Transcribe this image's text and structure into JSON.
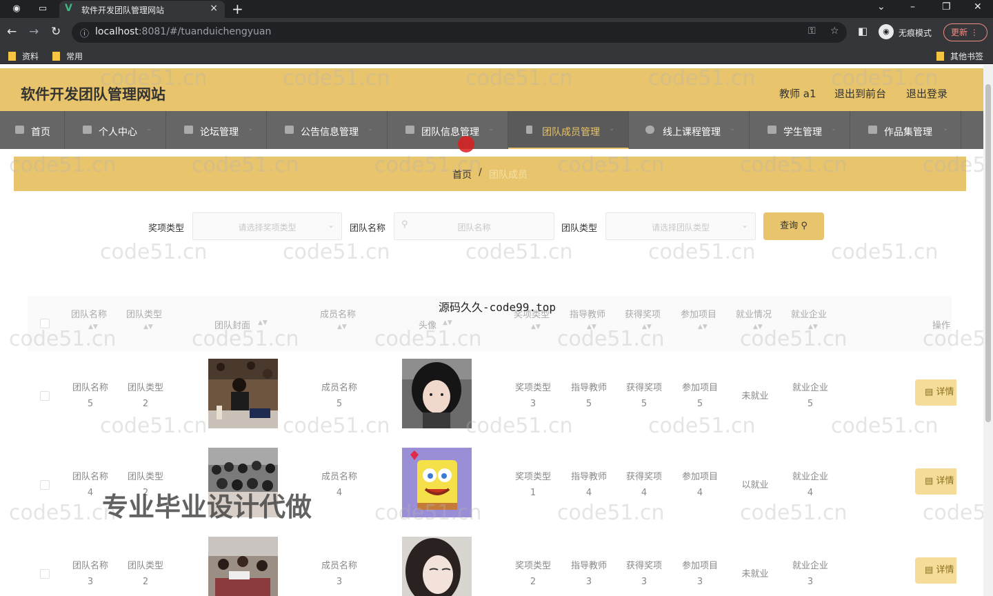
{
  "browser": {
    "tab_title": "软件开发团队管理网站",
    "url_host": "localhost",
    "url_rest": ":8081/#/tuanduichengyuan",
    "incognito_label": "无痕模式",
    "update_label": "更新",
    "bookmarks": [
      "资料",
      "常用"
    ],
    "other_bookmarks": "其他书签"
  },
  "site": {
    "title": "软件开发团队管理网站",
    "header_links": [
      "教师 a1",
      "退出到前台",
      "退出登录"
    ]
  },
  "nav": [
    {
      "label": "首页"
    },
    {
      "label": "个人中心"
    },
    {
      "label": "论坛管理"
    },
    {
      "label": "公告信息管理"
    },
    {
      "label": "团队信息管理"
    },
    {
      "label": "团队成员管理"
    },
    {
      "label": "线上课程管理"
    },
    {
      "label": "学生管理"
    },
    {
      "label": "作品集管理"
    }
  ],
  "breadcrumb": {
    "home": "首页",
    "sep": "/",
    "current": "团队成员"
  },
  "filters": {
    "award_label": "奖项类型",
    "award_placeholder": "请选择奖项类型",
    "team_name_label": "团队名称",
    "team_name_placeholder": "团队名称",
    "team_type_label": "团队类型",
    "team_type_placeholder": "请选择团队类型",
    "query_label": "查询"
  },
  "table": {
    "headers": [
      "团队名称",
      "团队类型",
      "团队封面",
      "成员名称",
      "头像",
      "奖项类型",
      "指导教师",
      "获得奖项",
      "参加项目",
      "就业情况",
      "就业企业",
      "操作"
    ],
    "detail_label": "详情",
    "rows": [
      {
        "team_name": "团队名称",
        "team_name_no": "5",
        "team_type": "团队类型",
        "team_type_no": "2",
        "member": "成员名称",
        "member_no": "5",
        "award": "奖项类型",
        "award_no": "3",
        "teacher": "指导教师",
        "teacher_no": "5",
        "prize": "获得奖项",
        "prize_no": "5",
        "project": "参加项目",
        "project_no": "5",
        "employment": "未就业",
        "company": "就业企业",
        "company_no": "5"
      },
      {
        "team_name": "团队名称",
        "team_name_no": "4",
        "team_type": "团队类型",
        "team_type_no": "2",
        "member": "成员名称",
        "member_no": "4",
        "award": "奖项类型",
        "award_no": "1",
        "teacher": "指导教师",
        "teacher_no": "4",
        "prize": "获得奖项",
        "prize_no": "4",
        "project": "参加项目",
        "project_no": "4",
        "employment": "以就业",
        "company": "就业企业",
        "company_no": "4"
      },
      {
        "team_name": "团队名称",
        "team_name_no": "3",
        "team_type": "团队类型",
        "team_type_no": "2",
        "member": "成员名称",
        "member_no": "3",
        "award": "奖项类型",
        "award_no": "2",
        "teacher": "指导教师",
        "teacher_no": "3",
        "prize": "获得奖项",
        "prize_no": "3",
        "project": "参加项目",
        "project_no": "3",
        "employment": "未就业",
        "company": "就业企业",
        "company_no": "3"
      }
    ]
  },
  "overlays": {
    "watermark": "code51.cn",
    "top_text": "源码久久-code99.top",
    "big_text": "专业毕业设计代做"
  }
}
